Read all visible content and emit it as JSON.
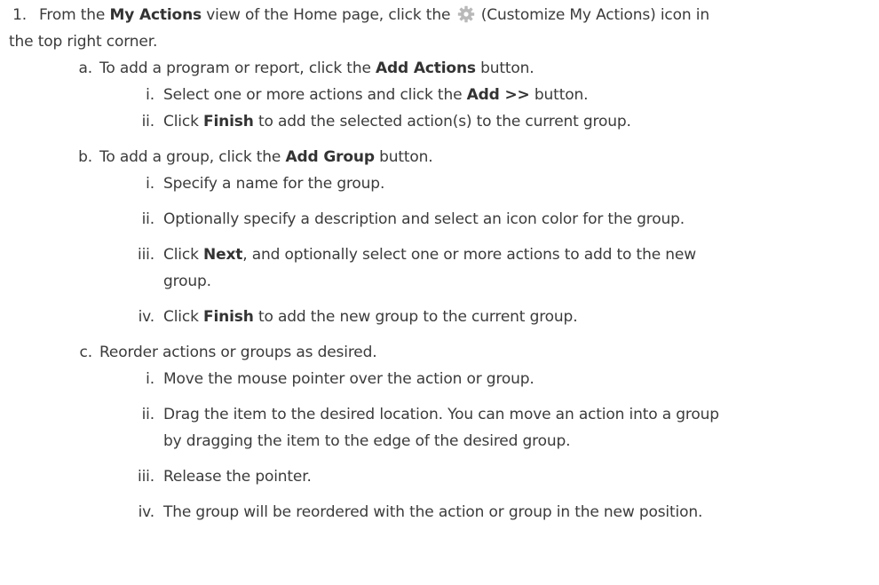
{
  "step1": {
    "number": "1.",
    "text_before_bold": "From the ",
    "bold": "My Actions",
    "text_after_bold": " view of the Home page, click the ",
    "icon": "gear-icon",
    "icon_color": "#b9b9b9",
    "text_after_icon": " (Customize My Actions) icon in",
    "continuation": "the top right corner."
  },
  "a": {
    "letter": "a.",
    "text_before_bold": "To add a program or report, click the ",
    "bold": "Add Actions",
    "text_after_bold": " button.",
    "items": [
      {
        "num": "i.",
        "before": "Select one or more actions and click the ",
        "bold": "Add >>",
        "after": " button."
      },
      {
        "num": "ii.",
        "before": "Click ",
        "bold": "Finish",
        "after": " to add the selected action(s) to the current group."
      }
    ]
  },
  "b": {
    "letter": "b.",
    "text_before_bold": "To add a group, click the ",
    "bold": "Add Group",
    "text_after_bold": " button.",
    "items": [
      {
        "num": "i.",
        "text": "Specify a name for the group."
      },
      {
        "num": "ii.",
        "text": "Optionally specify a description and select an icon color for the group."
      },
      {
        "num": "iii.",
        "before": "Click ",
        "bold": "Next",
        "after": ", and optionally select one or more actions to add to the new",
        "continuation": "group."
      },
      {
        "num": "iv.",
        "before": "Click ",
        "bold": "Finish",
        "after": " to add the new group to the current group."
      }
    ]
  },
  "c": {
    "letter": "c.",
    "text": "Reorder actions or groups as desired.",
    "items": [
      {
        "num": "i.",
        "text": "Move the mouse pointer over the action or group."
      },
      {
        "num": "ii.",
        "text": "Drag the item to the desired location. You can move an action into a group",
        "continuation": "by dragging the item to the edge of the desired group."
      },
      {
        "num": "iii.",
        "text": "Release the pointer."
      },
      {
        "num": "iv.",
        "text": "The group will be reordered with the action or group in the new position."
      }
    ]
  }
}
